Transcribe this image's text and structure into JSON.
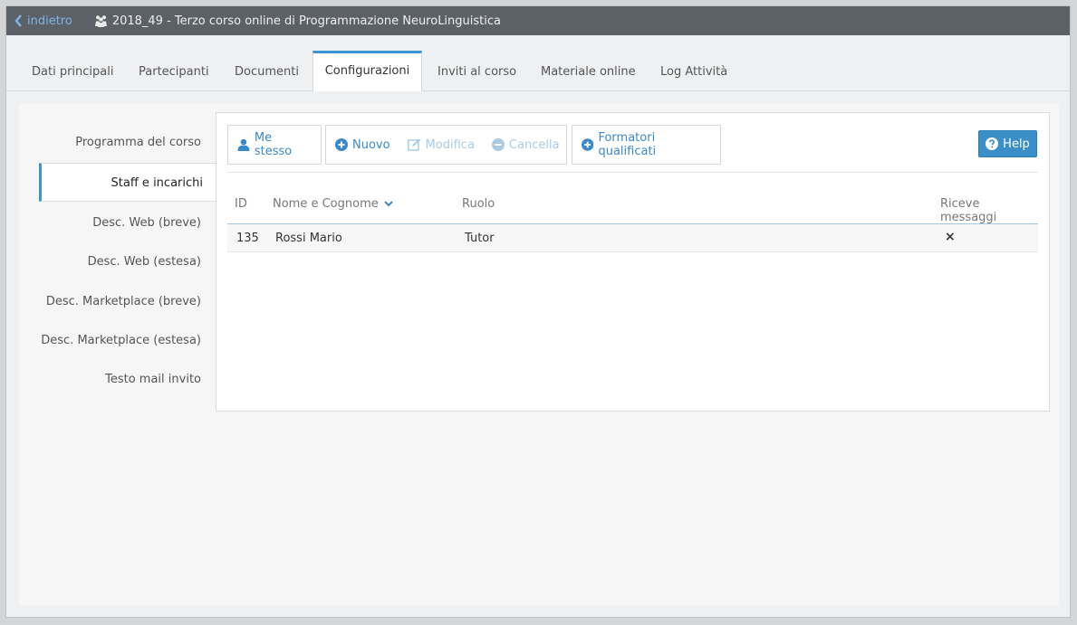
{
  "titlebar": {
    "back_label": "indietro",
    "course_title": "2018_49 - Terzo corso online di Programmazione NeuroLinguistica"
  },
  "tabs": [
    {
      "label": "Dati principali",
      "active": false
    },
    {
      "label": "Partecipanti",
      "active": false
    },
    {
      "label": "Documenti",
      "active": false
    },
    {
      "label": "Configurazioni",
      "active": true
    },
    {
      "label": "Inviti al corso",
      "active": false
    },
    {
      "label": "Materiale online",
      "active": false
    },
    {
      "label": "Log Attività",
      "active": false
    }
  ],
  "sidenav": [
    {
      "label": "Programma del corso",
      "active": false
    },
    {
      "label": "Staff e incarichi",
      "active": true
    },
    {
      "label": "Desc. Web (breve)",
      "active": false
    },
    {
      "label": "Desc. Web (estesa)",
      "active": false
    },
    {
      "label": "Desc. Marketplace (breve)",
      "active": false
    },
    {
      "label": "Desc. Marketplace (estesa)",
      "active": false
    },
    {
      "label": "Testo mail invito",
      "active": false
    }
  ],
  "toolbar": {
    "me_stesso": "Me stesso",
    "nuovo": "Nuovo",
    "modifica": "Modifica",
    "cancella": "Cancella",
    "formatori": "Formatori qualificati",
    "help": "Help"
  },
  "table": {
    "columns": [
      "ID",
      "Nome e Cognome",
      "Ruolo",
      "Riceve messaggi"
    ],
    "rows": [
      {
        "id": "135",
        "name": "Rossi Mario",
        "role": "Tutor",
        "receives": "×"
      }
    ]
  },
  "colors": {
    "accent": "#3a95d2",
    "titlebar": "#5b6167",
    "link": "#3a89c9"
  }
}
